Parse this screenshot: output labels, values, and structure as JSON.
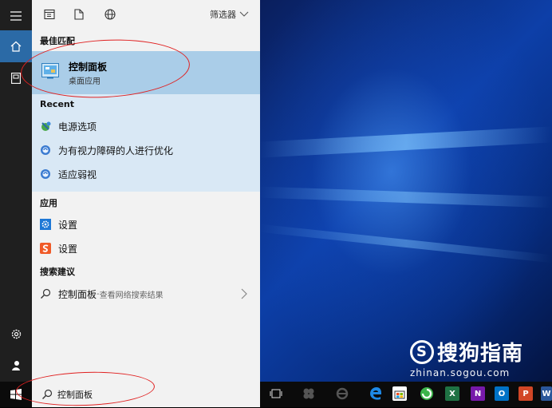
{
  "toolbar": {
    "filter_label": "筛选器"
  },
  "sections": {
    "best": "最佳匹配",
    "recent": "Recent",
    "apps": "应用",
    "suggest": "搜索建议"
  },
  "best_match": {
    "title": "控制面板",
    "subtitle": "桌面应用"
  },
  "recent": [
    {
      "label": "电源选项",
      "icon": "power-options-icon"
    },
    {
      "label": "为有视力障碍的人进行优化",
      "icon": "ease-of-access-icon"
    },
    {
      "label": "适应弱视",
      "icon": "ease-of-access-icon"
    }
  ],
  "apps": [
    {
      "label": "设置",
      "icon": "settings-gear-icon"
    },
    {
      "label": "设置",
      "icon": "sogou-settings-icon"
    }
  ],
  "suggestion": {
    "term": "控制面板",
    "sep": " - ",
    "hint": "查看网络搜索结果"
  },
  "search": {
    "query": "控制面板"
  },
  "watermark": {
    "brand": "搜狗指南",
    "url": "zhinan.sogou.com"
  },
  "taskbar": {
    "excel": "X",
    "onenote": "N",
    "outlook": "O",
    "ppt": "P",
    "word": "W"
  },
  "colors": {
    "accent": "#2b6aa6",
    "selected": "#aacde8",
    "recent_bg": "#d9e8f5",
    "annotation": "#e02020"
  }
}
